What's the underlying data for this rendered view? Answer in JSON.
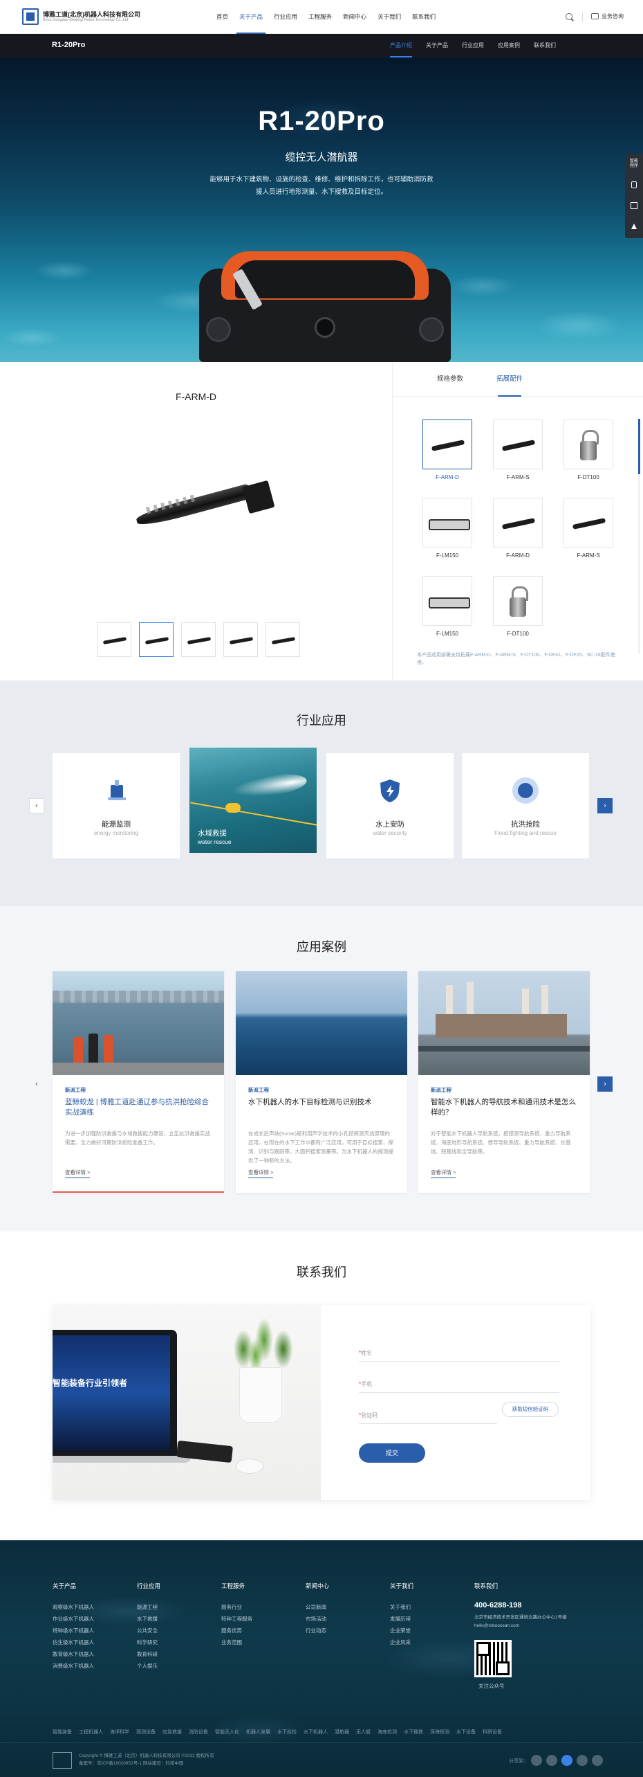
{
  "header": {
    "company_cn": "博雅工道(北京)机器人科技有限公司",
    "company_en": "Boya Gongdao (Beijing) Robot Technology Co.,Ltd",
    "nav": [
      "首页",
      "关于产品",
      "行业应用",
      "工程服务",
      "新闻中心",
      "关于我们",
      "联系我们"
    ],
    "active_nav": 1,
    "consult_label": "业务咨询"
  },
  "subnav": {
    "title": "R1-20Pro",
    "tabs": [
      "产品介绍",
      "关于产品",
      "行业应用",
      "应用案例",
      "联系我们"
    ],
    "active_tab": 0
  },
  "hero": {
    "title": "R1-20Pro",
    "subtitle": "缆控无人潜航器",
    "description": "能够用于水下建筑物、设施的检查、维修、维护和拆除工作，也可辅助消防救援人员进行地形测量、水下搜救及目标定位。"
  },
  "side_float": {
    "items": [
      "智能\n程序",
      "phone-icon",
      "qrcode-icon",
      "top-icon"
    ]
  },
  "product": {
    "name": "F-ARM-D",
    "thumb_count": 5,
    "active_thumb": 1,
    "tabs": [
      "规格参数",
      "拓展配件"
    ],
    "active_tab": 1,
    "accessories": [
      {
        "label": "F-ARM-D",
        "kind": "torch",
        "active": true
      },
      {
        "label": "F-ARM-S",
        "kind": "torch",
        "active": false
      },
      {
        "label": "F-DT100",
        "kind": "lock",
        "active": false
      },
      {
        "label": "F-LM150",
        "kind": "light",
        "active": false
      },
      {
        "label": "F-ARM-D",
        "kind": "torch",
        "active": false
      },
      {
        "label": "F-ARM-S",
        "kind": "torch",
        "active": false
      },
      {
        "label": "F-LM150",
        "kind": "light",
        "active": false
      },
      {
        "label": "F-DT100",
        "kind": "lock",
        "active": false
      }
    ],
    "note": "本产品适用部署支持拓展F-ARM-D、F-ARM-S、F-DT100、F-DF41、F-DF15、SC-16配件使用。"
  },
  "industry": {
    "title": "行业应用",
    "cards": [
      {
        "name": "能源监测",
        "en": "energy monitoring",
        "icon": "energy-icon"
      },
      {
        "name": "水域救援",
        "en": "water rescue",
        "icon": "photo"
      },
      {
        "name": "水上安防",
        "en": "water security",
        "icon": "shield-icon"
      },
      {
        "name": "抗洪抢险",
        "en": "Flood fighting and rescue",
        "icon": "flood-icon"
      }
    ]
  },
  "cases": {
    "title": "应用案例",
    "items": [
      {
        "tag": "新派工程",
        "title": "蓝鲸蛟龙 | 博雅工道赴通辽参与抗洪抢险综合实战演练",
        "desc": "为进一步加强防洪救援与水域救援能力建设，立足抗洪救援实战需要，全力做好汛期防洪抢险准备工作。",
        "more": "查看详情 >"
      },
      {
        "tag": "新派工程",
        "title": "水下机器人的水下目标检测与识别技术",
        "desc": "在成长后声纳(Sonar)是利用声学技术的小孔径探测天线原理的应用，在现在的水下工作中都有广泛应用，可用于目标搜索、探测、识别与跟踪等，大面积搜索测量等。为水下机器人的探测提供了一种新的方法。",
        "more": "查看详情 >"
      },
      {
        "tag": "新派工程",
        "title": "智能水下机器人的导航技术和通讯技术是怎么样的？",
        "desc": "对于智能水下机器人导航系统，按感测导航系统、重力导航系统、海底地形导航系统、惯导导航系统、重力导航系统、长基线、短基线和全导航等。",
        "more": "查看详情 >"
      }
    ]
  },
  "contact": {
    "title": "联系我们",
    "laptop_text": "智能装备行业引领者",
    "fields": [
      "姓名",
      "手机",
      "验证码"
    ],
    "code_button": "获取短信验证码",
    "submit": "提交"
  },
  "footer": {
    "columns": [
      {
        "title": "关于产品",
        "items": [
          "观察级水下机器人",
          "作业级水下机器人",
          "特种级水下机器人",
          "仿生级水下机器人",
          "教育级水下机器人",
          "消费级水下机器人"
        ]
      },
      {
        "title": "行业应用",
        "items": [
          "能源工程",
          "水下救援",
          "公共安全",
          "科学研究",
          "教育科研",
          "个人娱乐"
        ]
      },
      {
        "title": "工程服务",
        "items": [
          "服务行业",
          "特种工程服务",
          "服务优势",
          "业务范围"
        ]
      },
      {
        "title": "新闻中心",
        "items": [
          "公司新闻",
          "市场活动",
          "行业动态"
        ]
      },
      {
        "title": "关于我们",
        "items": [
          "关于我们",
          "发展历程",
          "企业荣誉",
          "企业风采"
        ]
      }
    ],
    "contact_title": "联系我们",
    "phone": "400-6288-198",
    "address": "北京市经济技术开发区通锐北路办公中心1号楼",
    "email": "hello@roboocean.com",
    "qr_label": "关注公众号",
    "links": [
      "智能装备",
      "工程机器人",
      "海洋科学",
      "观测设备",
      "应急救援",
      "消防设备",
      "智能无人化",
      "机器人发展",
      "水下巡检",
      "水下机器人",
      "潜航器",
      "无人艇",
      "海底检测",
      "水下搜救",
      "深海探测",
      "水下设备",
      "科研设备"
    ],
    "copyright": "Copyright © 博雅工道（北京）机器人科技有限公司 ©2022  版权所有",
    "icp": "备案号：京ICP备19020952号-1  网站建设：科技中国",
    "share_label": "分享到："
  }
}
